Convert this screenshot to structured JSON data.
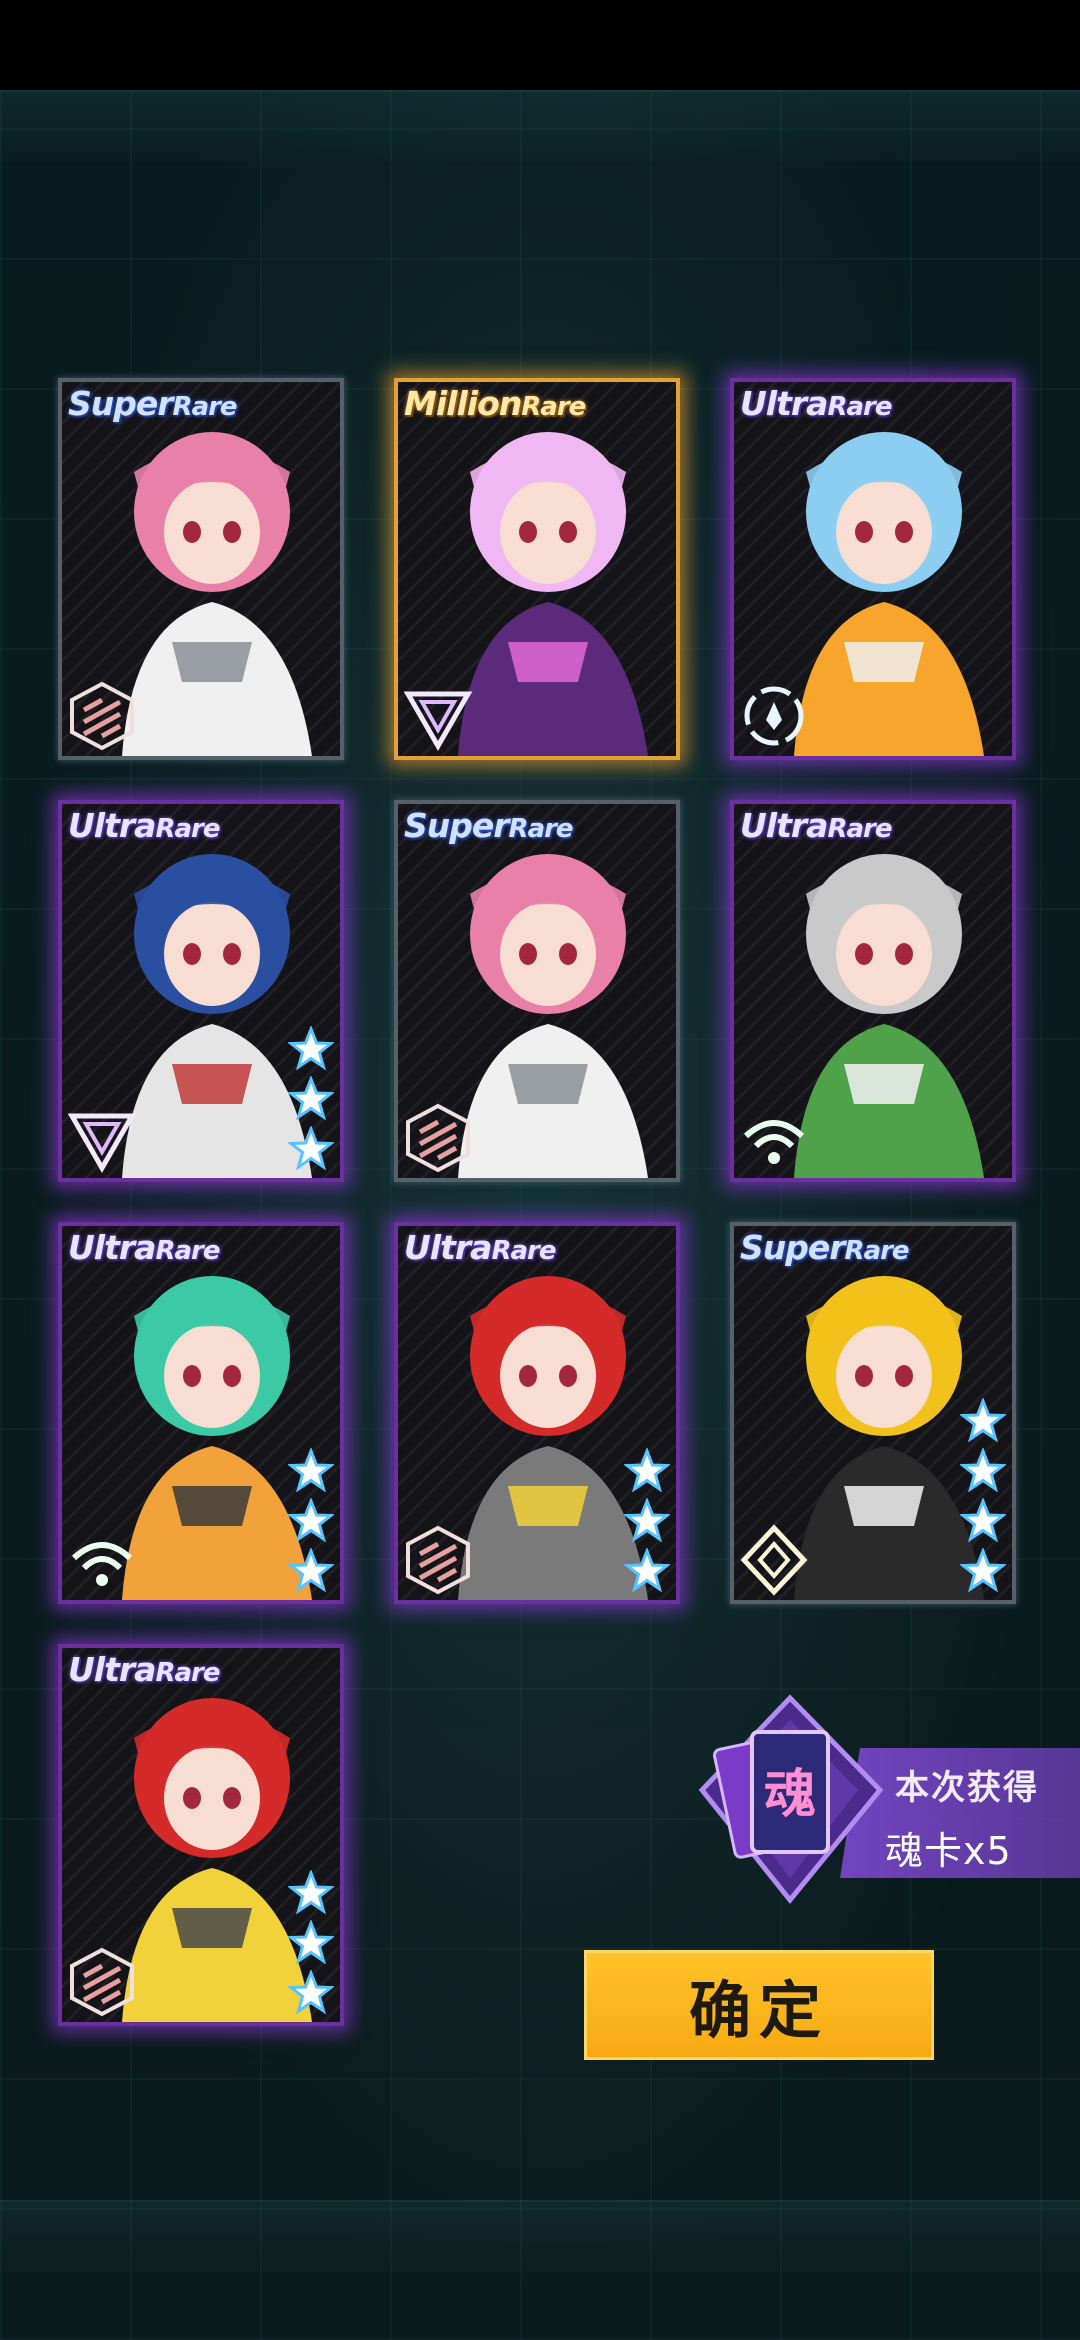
{
  "cards": [
    {
      "rarity_main": "Super",
      "rarity_sub": "Rare",
      "tier": "super",
      "class_icon": "hex-stripe-icon",
      "stars": 0,
      "art_colors": [
        "#e880a8",
        "#f0f0f0",
        "#8a8f96"
      ]
    },
    {
      "rarity_main": "Million",
      "rarity_sub": "Rare",
      "tier": "million",
      "class_icon": "triangle-icon",
      "stars": 0,
      "art_colors": [
        "#f0b8f2",
        "#5b2a7a",
        "#e36ad8"
      ]
    },
    {
      "rarity_main": "Ultra",
      "rarity_sub": "Rare",
      "tier": "ultra",
      "class_icon": "ring-icon",
      "stars": 0,
      "art_colors": [
        "#8ccdf2",
        "#f7a52c",
        "#f0f0f0"
      ]
    },
    {
      "rarity_main": "Ultra",
      "rarity_sub": "Rare",
      "tier": "ultra",
      "class_icon": "triangle-icon",
      "stars": 3,
      "art_colors": [
        "#2b4fa0",
        "#e5e5e5",
        "#c23a3a"
      ]
    },
    {
      "rarity_main": "Super",
      "rarity_sub": "Rare",
      "tier": "super",
      "class_icon": "hex-stripe-icon",
      "stars": 0,
      "art_colors": [
        "#e880a8",
        "#f0f0f0",
        "#8a8f96"
      ]
    },
    {
      "rarity_main": "Ultra",
      "rarity_sub": "Rare",
      "tier": "ultra",
      "class_icon": "wifi-icon",
      "stars": 0,
      "art_colors": [
        "#c9c9c9",
        "#4fa24a",
        "#f2f2f2"
      ]
    },
    {
      "rarity_main": "Ultra",
      "rarity_sub": "Rare",
      "tier": "ultra",
      "class_icon": "wifi-icon",
      "stars": 3,
      "art_colors": [
        "#3cc9a5",
        "#f2a23a",
        "#3b3b3b"
      ]
    },
    {
      "rarity_main": "Ultra",
      "rarity_sub": "Rare",
      "tier": "ultra",
      "class_icon": "hex-stripe-icon",
      "stars": 3,
      "art_colors": [
        "#d42a2a",
        "#7a7a7a",
        "#f2d23a"
      ]
    },
    {
      "rarity_main": "Super",
      "rarity_sub": "Rare",
      "tier": "super",
      "class_icon": "diamond-icon",
      "stars": 4,
      "art_colors": [
        "#f2c21c",
        "#2a2a2a",
        "#f2f2f2"
      ]
    },
    {
      "rarity_main": "Ultra",
      "rarity_sub": "Rare",
      "tier": "ultra",
      "class_icon": "hex-stripe-icon",
      "stars": 3,
      "art_colors": [
        "#d42a2a",
        "#f2d23a",
        "#4a4a4a"
      ]
    }
  ],
  "reward": {
    "card_glyph": "魂",
    "title": "本次获得",
    "amount": "魂卡x5"
  },
  "confirm_label": "确定"
}
